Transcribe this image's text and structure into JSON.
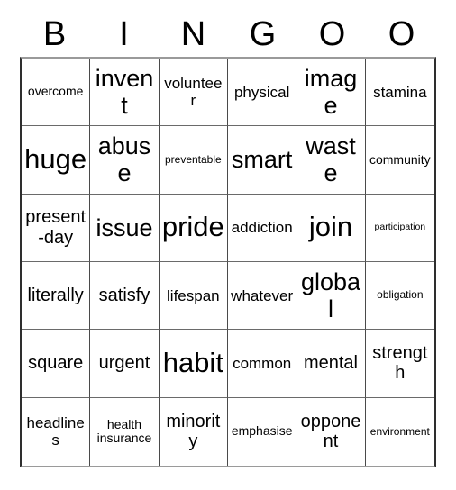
{
  "card": {
    "title": "Bingo Card",
    "header_letters": [
      "B",
      "I",
      "N",
      "G",
      "O",
      "O"
    ],
    "columns": 6,
    "rows": 6,
    "colors": {
      "background": "#ffffff",
      "text": "#000000",
      "grid_line": "#4a4a4a",
      "grid_outer": "#2e2e2e"
    },
    "cells": [
      [
        {
          "text": "overcome",
          "size": "xs"
        },
        {
          "text": "invent",
          "size": "xl"
        },
        {
          "text": "volunteer",
          "size": "sm"
        },
        {
          "text": "physical",
          "size": "sm"
        },
        {
          "text": "image",
          "size": "xl"
        },
        {
          "text": "stamina",
          "size": "sm"
        }
      ],
      [
        {
          "text": "huge",
          "size": "xxl"
        },
        {
          "text": "abuse",
          "size": "xl"
        },
        {
          "text": "preventable",
          "size": "xxs"
        },
        {
          "text": "smart",
          "size": "xl"
        },
        {
          "text": "waste",
          "size": "xl"
        },
        {
          "text": "community",
          "size": "xs"
        }
      ],
      [
        {
          "text": "present-day",
          "size": "md"
        },
        {
          "text": "issue",
          "size": "xl"
        },
        {
          "text": "pride",
          "size": "xxl"
        },
        {
          "text": "addiction",
          "size": "sm"
        },
        {
          "text": "join",
          "size": "xxl"
        },
        {
          "text": "participation",
          "size": "tiny"
        }
      ],
      [
        {
          "text": "literally",
          "size": "md"
        },
        {
          "text": "satisfy",
          "size": "md"
        },
        {
          "text": "lifespan",
          "size": "sm"
        },
        {
          "text": "whatever",
          "size": "sm"
        },
        {
          "text": "global",
          "size": "xl"
        },
        {
          "text": "obligation",
          "size": "xxs"
        }
      ],
      [
        {
          "text": "square",
          "size": "md"
        },
        {
          "text": "urgent",
          "size": "md"
        },
        {
          "text": "habit",
          "size": "xxl"
        },
        {
          "text": "common",
          "size": "sm"
        },
        {
          "text": "mental",
          "size": "md"
        },
        {
          "text": "strength",
          "size": "md"
        }
      ],
      [
        {
          "text": "headlines",
          "size": "sm"
        },
        {
          "text": "health insurance",
          "size": "xs"
        },
        {
          "text": "minority",
          "size": "md"
        },
        {
          "text": "emphasise",
          "size": "xs"
        },
        {
          "text": "opponent",
          "size": "md"
        },
        {
          "text": "environment",
          "size": "xxs"
        }
      ]
    ]
  }
}
